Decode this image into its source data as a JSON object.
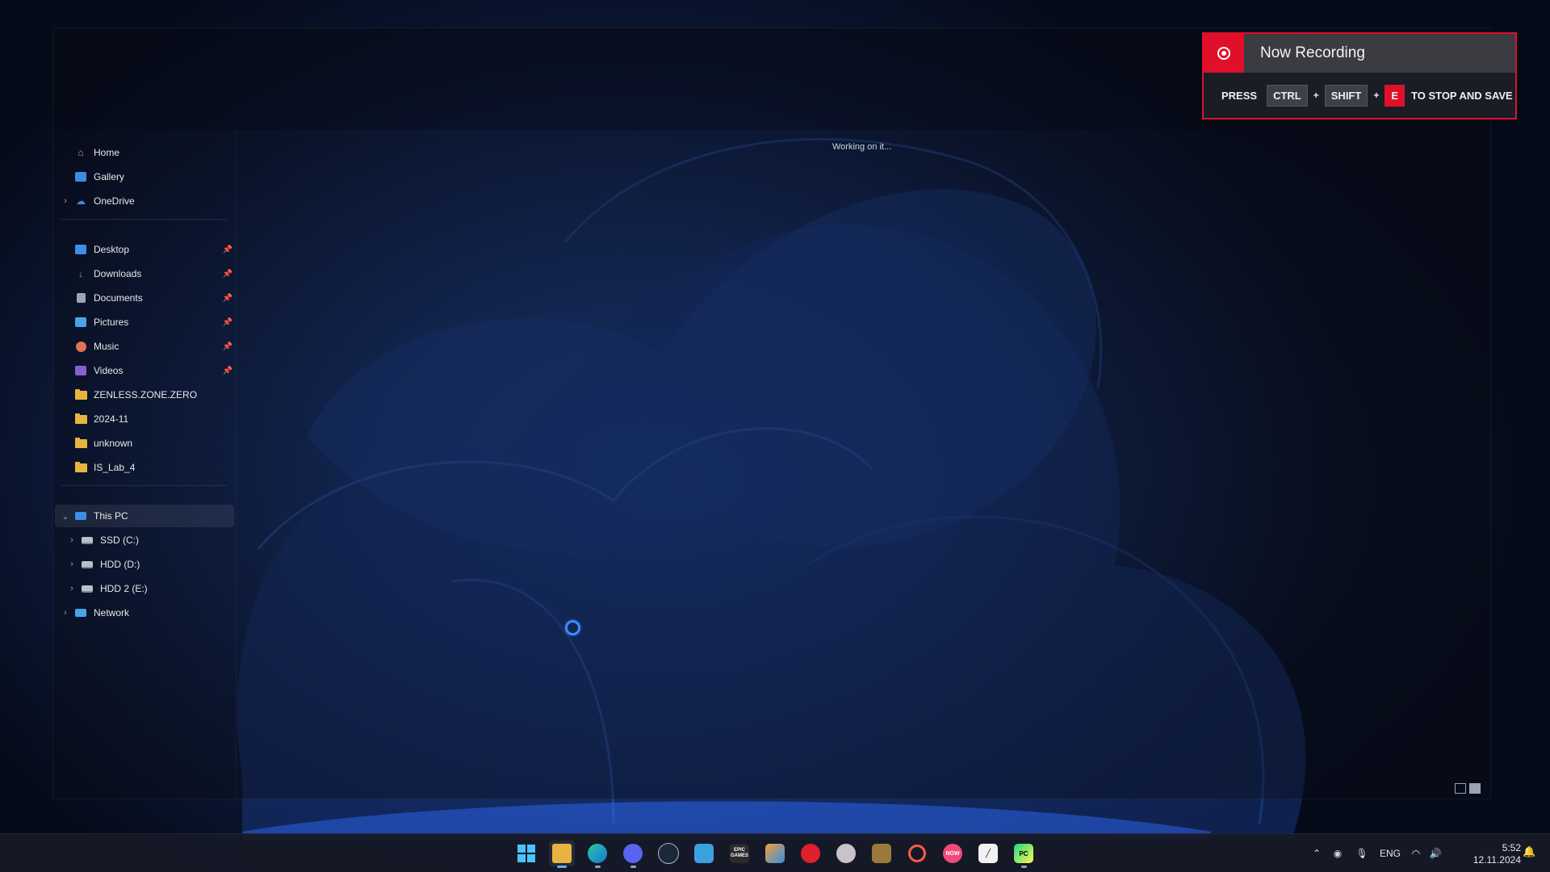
{
  "sidebar": {
    "items": [
      {
        "label": "Home",
        "icon": "home-icon"
      },
      {
        "label": "Gallery",
        "icon": "gallery-icon"
      },
      {
        "label": "OneDrive",
        "icon": "onedrive-icon"
      },
      {
        "label": "Desktop",
        "icon": "desktop-icon",
        "pinned": true
      },
      {
        "label": "Downloads",
        "icon": "downloads-icon",
        "pinned": true
      },
      {
        "label": "Documents",
        "icon": "documents-icon",
        "pinned": true
      },
      {
        "label": "Pictures",
        "icon": "pictures-icon",
        "pinned": true
      },
      {
        "label": "Music",
        "icon": "music-icon",
        "pinned": true
      },
      {
        "label": "Videos",
        "icon": "videos-icon",
        "pinned": true
      },
      {
        "label": "ZENLESS.ZONE.ZERO",
        "icon": "folder-icon"
      },
      {
        "label": "2024-11",
        "icon": "folder-icon"
      },
      {
        "label": "unknown",
        "icon": "folder-icon"
      },
      {
        "label": "IS_Lab_4",
        "icon": "folder-icon"
      },
      {
        "label": "This PC",
        "icon": "this-pc-icon",
        "selected": true
      },
      {
        "label": "SSD (C:)",
        "icon": "drive-icon"
      },
      {
        "label": "HDD (D:)",
        "icon": "drive-icon"
      },
      {
        "label": "HDD 2 (E:)",
        "icon": "drive-icon"
      },
      {
        "label": "Network",
        "icon": "network-icon"
      }
    ]
  },
  "main": {
    "status_text": "Working on it..."
  },
  "recording": {
    "title": "Now Recording",
    "press": "PRESS",
    "key1": "CTRL",
    "key2": "SHIFT",
    "key3": "E",
    "plus": "+",
    "suffix": "TO STOP AND SAVE",
    "accent": "#e0102a"
  },
  "taskbar": {
    "apps": [
      {
        "name": "start",
        "label": ""
      },
      {
        "name": "file-explorer",
        "label": ""
      },
      {
        "name": "edge",
        "label": ""
      },
      {
        "name": "discord",
        "label": ""
      },
      {
        "name": "steam",
        "label": ""
      },
      {
        "name": "app-blue",
        "label": ""
      },
      {
        "name": "epic-games",
        "label": "EPIC GAMES"
      },
      {
        "name": "app-cube",
        "label": ""
      },
      {
        "name": "app-red",
        "label": ""
      },
      {
        "name": "app-character",
        "label": ""
      },
      {
        "name": "app-game",
        "label": ""
      },
      {
        "name": "app-ea",
        "label": ""
      },
      {
        "name": "app-now",
        "label": "NOW"
      },
      {
        "name": "app-notes",
        "label": ""
      },
      {
        "name": "pycharm",
        "label": "PC"
      }
    ],
    "tray": {
      "language": "ENG",
      "time": "5:52",
      "date": "12.11.2024"
    }
  }
}
